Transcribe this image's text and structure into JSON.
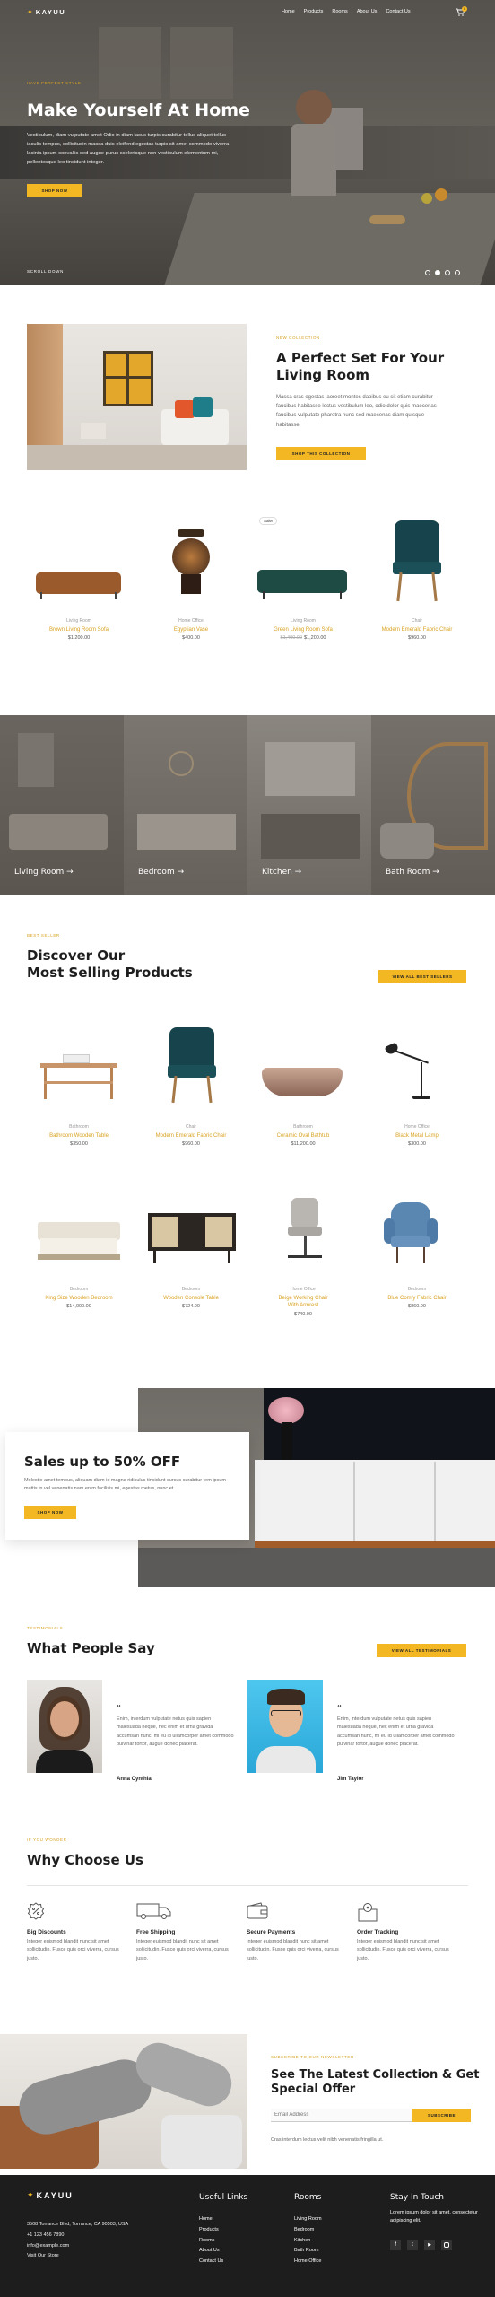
{
  "nav": {
    "logo": "KAYUU",
    "items": [
      "Home",
      "Products",
      "Rooms",
      "About Us",
      "Contact Us"
    ],
    "cart_count": "0"
  },
  "hero": {
    "eyebrow": "HAVE PERFECT STYLE",
    "title": "Make Yourself At Home",
    "text": "Vestibulum, diam vulputate amet Odio in diam lacus turpis curabitur tellus aliquet tellus iaculis tempus, sollicitudin massa duis eleifend egestas turpis sit amet commodo viverra lacinia ipsum convallis sed augue purus scelerisque non vestibulum elementum mi, pellentesque leo tincidunt integer.",
    "button": "SHOP NOW",
    "scroll": "SCROLL DOWN"
  },
  "collection": {
    "eyebrow": "NEW COLLECTION",
    "title_line1": "A Perfect Set For Your",
    "title_line2": "Living Room",
    "text": "Massa cras egestas laoreet montes dapibus eu sit etiam curabitur faucibus habitasse lectus vestibulum leo, odio dolor quis maecenas faucibus vulputate pharetra nunc sed maecenas diam quisque habitasse.",
    "button": "SHOP THIS COLLECTION"
  },
  "collection_products": [
    {
      "category": "Living Room",
      "name": "Brown Living Room Sofa",
      "price": "$1,200.00",
      "old_price": ""
    },
    {
      "category": "Home Office",
      "name": "Egyptian Vase",
      "price": "$400.00",
      "old_price": ""
    },
    {
      "category": "Living Room",
      "name": "Green Living Room Sofa",
      "price": "$1,200.00",
      "old_price": "$1,400.00",
      "badge": "Sale!"
    },
    {
      "category": "Chair",
      "name": "Modern Emerald Fabric Chair",
      "price": "$960.00",
      "old_price": ""
    }
  ],
  "rooms": [
    "Living Room →",
    "Bedroom →",
    "Kitchen →",
    "Bath Room →"
  ],
  "best": {
    "eyebrow": "BEST SELLER",
    "title_line1": "Discover Our",
    "title_line2": "Most Selling Products",
    "button": "VIEW ALL BEST SELLERS"
  },
  "best_products": [
    {
      "category": "Bathroom",
      "name": "Bathroom Wooden Table",
      "price": "$350.00"
    },
    {
      "category": "Chair",
      "name": "Modern Emerald Fabric Chair",
      "price": "$960.00"
    },
    {
      "category": "Bathroom",
      "name": "Ceramic Oval Bathtub",
      "price": "$11,200.00"
    },
    {
      "category": "Home Office",
      "name": "Black Metal Lamp",
      "price": "$300.00"
    },
    {
      "category": "Bedroom",
      "name": "King Size Wooden Bedroom",
      "price": "$14,000.00"
    },
    {
      "category": "Bedroom",
      "name": "Wooden Console Table",
      "price": "$724.00"
    },
    {
      "category": "Home Office",
      "name": "Beige Working Chair With Armrest",
      "price": "$740.00"
    },
    {
      "category": "Bedroom",
      "name": "Blue Comfy Fabric Chair",
      "price": "$860.00"
    }
  ],
  "sale": {
    "title": "Sales up to 50% OFF",
    "text": "Molestie amet tempus, aliquam diam id magna ridiculus tincidunt cursus curabitur tem ipsum mattis in vel venenatis nam enim facilisis mi, egestas metus, nunc et.",
    "button": "SHOP NOW"
  },
  "testimonials": {
    "eyebrow": "TESTIMONIALS",
    "title": "What People Say",
    "button": "VIEW ALL TESTIMONIALS",
    "items": [
      {
        "text": "Enim, interdum vulputate netus quis sapien malesuada neque, nec enim et urna gravida accumsan nunc, mi eu id ullamcorper amet commodo pulvinar tortor, augue donec placerat.",
        "name": "Anna Cynthia"
      },
      {
        "text": "Enim, interdum vulputate netus quis sapien malesuada neque, nec enim et urna gravida accumsan nunc, mi eu id ullamcorper amet commodo pulvinar tortor, augue donec placerat.",
        "name": "Jim Taylor"
      }
    ]
  },
  "why": {
    "eyebrow": "IF YOU WONDER",
    "title": "Why Choose Us",
    "items": [
      {
        "title": "Big Discounts",
        "text": "Integer euismod blandit nunc sit amet sollicitudin. Fusce quis orci viverra, cursus justo."
      },
      {
        "title": "Free Shipping",
        "text": "Integer euismod blandit nunc sit amet sollicitudin. Fusce quis orci viverra, cursus justo."
      },
      {
        "title": "Secure Payments",
        "text": "Integer euismod blandit nunc sit amet sollicitudin. Fusce quis orci viverra, cursus justo."
      },
      {
        "title": "Order Tracking",
        "text": "Integer euismod blandit nunc sit amet sollicitudin. Fusce quis orci viverra, cursus justo."
      }
    ]
  },
  "newsletter": {
    "eyebrow": "SUBSCRIBE TO OUR NEWSLETTER",
    "title_line1": "See The Latest Collection & Get",
    "title_line2": "Special Offer",
    "placeholder": "Email Address",
    "button": "SUBSCRIBE",
    "note": "Cras interdum lectus velit nibh venenatis fringilla ut."
  },
  "footer": {
    "logo": "KAYUU",
    "address": "3508 Torrance Blvd, Torrance, CA 90503, USA",
    "phone": "+1 123 456 7890",
    "email": "info@example.com",
    "visit": "Visit Our Store",
    "links_title": "Useful Links",
    "links": [
      "Home",
      "Products",
      "Rooms",
      "About Us",
      "Contact Us"
    ],
    "rooms_title": "Rooms",
    "rooms": [
      "Living Room",
      "Bedroom",
      "Kitchen",
      "Bath Room",
      "Home Office"
    ],
    "touch_title": "Stay In Touch",
    "touch_text": "Lorem ipsum dolor sit amet, consectetur adipiscing elit."
  },
  "colors": {
    "accent": "#f3b724",
    "dark": "#1b1b1b"
  }
}
